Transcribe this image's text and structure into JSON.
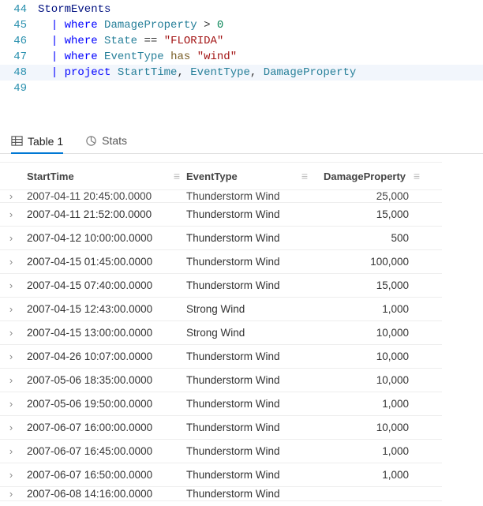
{
  "editor": {
    "lines": [
      {
        "num": "44",
        "tokens": [
          {
            "cls": "tk-ident",
            "t": "StormEvents"
          }
        ]
      },
      {
        "num": "45",
        "tokens": [
          {
            "cls": "",
            "t": "  "
          },
          {
            "cls": "tk-pipe",
            "t": "|"
          },
          {
            "cls": "",
            "t": " "
          },
          {
            "cls": "tk-kw",
            "t": "where"
          },
          {
            "cls": "",
            "t": " "
          },
          {
            "cls": "tk-col",
            "t": "DamageProperty"
          },
          {
            "cls": "",
            "t": " "
          },
          {
            "cls": "tk-op",
            "t": ">"
          },
          {
            "cls": "",
            "t": " "
          },
          {
            "cls": "tk-num",
            "t": "0"
          }
        ]
      },
      {
        "num": "46",
        "tokens": [
          {
            "cls": "",
            "t": "  "
          },
          {
            "cls": "tk-pipe",
            "t": "|"
          },
          {
            "cls": "",
            "t": " "
          },
          {
            "cls": "tk-kw",
            "t": "where"
          },
          {
            "cls": "",
            "t": " "
          },
          {
            "cls": "tk-col",
            "t": "State"
          },
          {
            "cls": "",
            "t": " "
          },
          {
            "cls": "tk-op",
            "t": "=="
          },
          {
            "cls": "",
            "t": " "
          },
          {
            "cls": "tk-str",
            "t": "\"FLORIDA\""
          }
        ]
      },
      {
        "num": "47",
        "tokens": [
          {
            "cls": "",
            "t": "  "
          },
          {
            "cls": "tk-pipe",
            "t": "|"
          },
          {
            "cls": "",
            "t": " "
          },
          {
            "cls": "tk-kw",
            "t": "where"
          },
          {
            "cls": "",
            "t": " "
          },
          {
            "cls": "tk-col",
            "t": "EventType"
          },
          {
            "cls": "",
            "t": " "
          },
          {
            "cls": "tk-fn",
            "t": "has"
          },
          {
            "cls": "",
            "t": " "
          },
          {
            "cls": "tk-str",
            "t": "\"wind\""
          }
        ]
      },
      {
        "num": "48",
        "highlight": true,
        "tokens": [
          {
            "cls": "",
            "t": "  "
          },
          {
            "cls": "tk-pipe",
            "t": "|"
          },
          {
            "cls": "",
            "t": " "
          },
          {
            "cls": "tk-kw",
            "t": "project"
          },
          {
            "cls": "",
            "t": " "
          },
          {
            "cls": "tk-col",
            "t": "StartTime"
          },
          {
            "cls": "tk-op",
            "t": ","
          },
          {
            "cls": "",
            "t": " "
          },
          {
            "cls": "tk-col",
            "t": "EventType"
          },
          {
            "cls": "tk-op",
            "t": ","
          },
          {
            "cls": "",
            "t": " "
          },
          {
            "cls": "tk-col",
            "t": "DamageProperty"
          }
        ]
      },
      {
        "num": "49",
        "tokens": []
      }
    ]
  },
  "tabs": {
    "table_label": "Table 1",
    "stats_label": "Stats"
  },
  "columns": {
    "start": "StartTime",
    "type": "EventType",
    "dmg": "DamageProperty",
    "menu_glyph": "≡"
  },
  "rows_top_clip": {
    "start": "2007-04-11 20:45:00.0000",
    "type": "Thunderstorm Wind",
    "dmg": "25,000"
  },
  "rows": [
    {
      "start": "2007-04-11 21:52:00.0000",
      "type": "Thunderstorm Wind",
      "dmg": "15,000"
    },
    {
      "start": "2007-04-12 10:00:00.0000",
      "type": "Thunderstorm Wind",
      "dmg": "500"
    },
    {
      "start": "2007-04-15 01:45:00.0000",
      "type": "Thunderstorm Wind",
      "dmg": "100,000"
    },
    {
      "start": "2007-04-15 07:40:00.0000",
      "type": "Thunderstorm Wind",
      "dmg": "15,000"
    },
    {
      "start": "2007-04-15 12:43:00.0000",
      "type": "Strong Wind",
      "dmg": "1,000"
    },
    {
      "start": "2007-04-15 13:00:00.0000",
      "type": "Strong Wind",
      "dmg": "10,000"
    },
    {
      "start": "2007-04-26 10:07:00.0000",
      "type": "Thunderstorm Wind",
      "dmg": "10,000"
    },
    {
      "start": "2007-05-06 18:35:00.0000",
      "type": "Thunderstorm Wind",
      "dmg": "10,000"
    },
    {
      "start": "2007-05-06 19:50:00.0000",
      "type": "Thunderstorm Wind",
      "dmg": "1,000"
    },
    {
      "start": "2007-06-07 16:00:00.0000",
      "type": "Thunderstorm Wind",
      "dmg": "10,000"
    },
    {
      "start": "2007-06-07 16:45:00.0000",
      "type": "Thunderstorm Wind",
      "dmg": "1,000"
    },
    {
      "start": "2007-06-07 16:50:00.0000",
      "type": "Thunderstorm Wind",
      "dmg": "1,000"
    }
  ],
  "rows_bot_clip": {
    "start": "2007-06-08 14:16:00.0000",
    "type": "Thunderstorm Wind",
    "dmg": ""
  },
  "glyphs": {
    "expand": "›"
  }
}
